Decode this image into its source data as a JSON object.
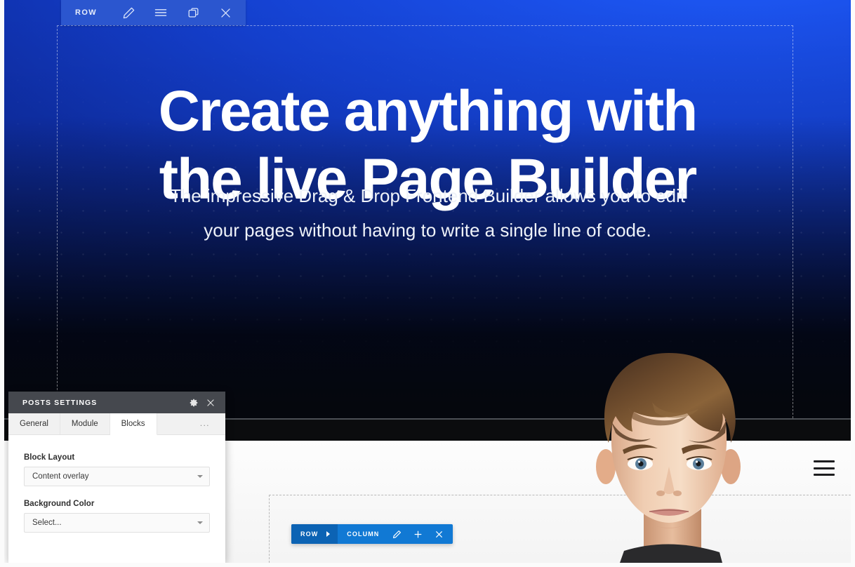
{
  "hero": {
    "headline_line1": "Create anything with",
    "headline_line2": "the live Page Builder",
    "subheadline_line1": "The impressive Drag & Drop Frontend Builder allows you to edit",
    "subheadline_line2": "your pages without having to write a single line of code.",
    "accent_blue": "#1a4fe8",
    "dark": "#05070d"
  },
  "row_toolbar": {
    "label": "ROW",
    "edit_icon": "pencil-icon",
    "menu_icon": "hamburger-icon",
    "duplicate_icon": "duplicate-icon",
    "close_icon": "close-icon",
    "background": "#2b56cf"
  },
  "column_toolbar": {
    "row_label": "ROW",
    "separator_icon": "chevron-right-icon",
    "column_label": "COLUMN",
    "edit_icon": "pencil-icon",
    "add_icon": "plus-icon",
    "close_icon": "close-icon",
    "row_background": "#0c63b4",
    "column_background": "#1179d4"
  },
  "lower_section": {
    "menu_icon": "hamburger-icon"
  },
  "settings_panel": {
    "title": "POSTS SETTINGS",
    "gear_icon": "gear-icon",
    "close_icon": "close-icon",
    "tabs": [
      {
        "label": "General",
        "active": false
      },
      {
        "label": "Module",
        "active": false
      },
      {
        "label": "Blocks",
        "active": true
      },
      {
        "label": "...",
        "active": false
      }
    ],
    "fields": [
      {
        "label": "Block Layout",
        "value": "Content overlay"
      },
      {
        "label": "Background Color",
        "value": "Select..."
      }
    ],
    "header_background": "#45484e"
  }
}
